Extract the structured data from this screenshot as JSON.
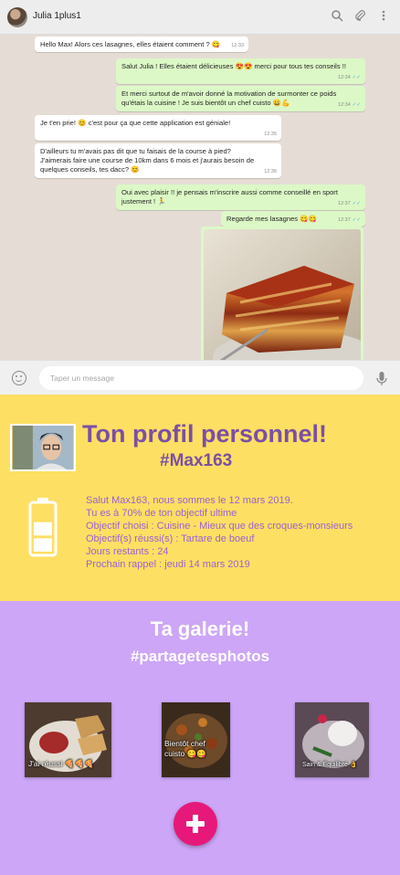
{
  "chat": {
    "contact_name": "Julia 1plus1",
    "input_placeholder": "Taper un message",
    "messages": [
      {
        "dir": "in",
        "text": "Hello Max! Alors ces lasagnes, elles étaient comment ? 😋",
        "time": "12:33"
      },
      {
        "dir": "out",
        "text": "Salut Julia ! Elles étaient délicieuses 😍😍 merci pour tous tes conseils !!",
        "time": "12:34"
      },
      {
        "dir": "out",
        "text": "Et merci surtout de m'avoir donné la motivation de surmonter ce poids qu'étais la cuisine ! Je suis bientôt un chef cuisto 😀💪",
        "time": "12:34"
      },
      {
        "dir": "in",
        "text": "Je t'en prie! 😊 c'est pour ça que cette application est géniale!",
        "time": "12:35"
      },
      {
        "dir": "in",
        "text": "D'ailleurs tu m'avais pas dit que tu faisais de la course à pied?\nJ'aimerais faire une course de 10km dans 6 mois et j'aurais besoin de quelques conseils, tes dacc? 😊",
        "time": "12:36"
      },
      {
        "dir": "out",
        "text": "Oui avec plaisir !! je pensais m'inscrire aussi comme conseillé en sport justement ! 🏃",
        "time": "12:37"
      },
      {
        "dir": "out",
        "text": "Regarde mes lasagnes 😋😋",
        "time": "12:37"
      }
    ]
  },
  "profile": {
    "title": "Ton profil personnel!",
    "tag": "#Max163",
    "lines": [
      "Salut Max163, nous sommes le 12 mars 2019.",
      "Tu es à 70% de ton objectif ultime",
      "Objectif choisi : Cuisine - Mieux que des croques-monsieurs",
      "Objectif(s) réussi(s) : Tartare de boeuf",
      "Jours restants : 24",
      "Prochain rappel : jeudi 14 mars 2019"
    ],
    "goal_progress": 0.7
  },
  "gallery": {
    "title": "Ta galerie!",
    "tag": "#partagetesphotos",
    "photos": [
      {
        "caption": "J'ai réussi 🍕🍕🍕"
      },
      {
        "caption": "Bientôt chef\ncuisto 😋😋"
      },
      {
        "caption": "Sain & Équilibré 👌"
      }
    ]
  },
  "colors": {
    "chat_bg": "#e5ddd5",
    "bubble_out": "#dcf8c6",
    "profile_bg": "#fddf63",
    "profile_text": "#9b62d2",
    "profile_title": "#7b4fa6",
    "gallery_bg": "#cda6f7",
    "add_button": "#e6197a"
  },
  "icons": [
    "search-icon",
    "paperclip-icon",
    "menu-dots-icon",
    "emoji-icon",
    "mic-icon",
    "battery-icon",
    "plus-icon"
  ]
}
